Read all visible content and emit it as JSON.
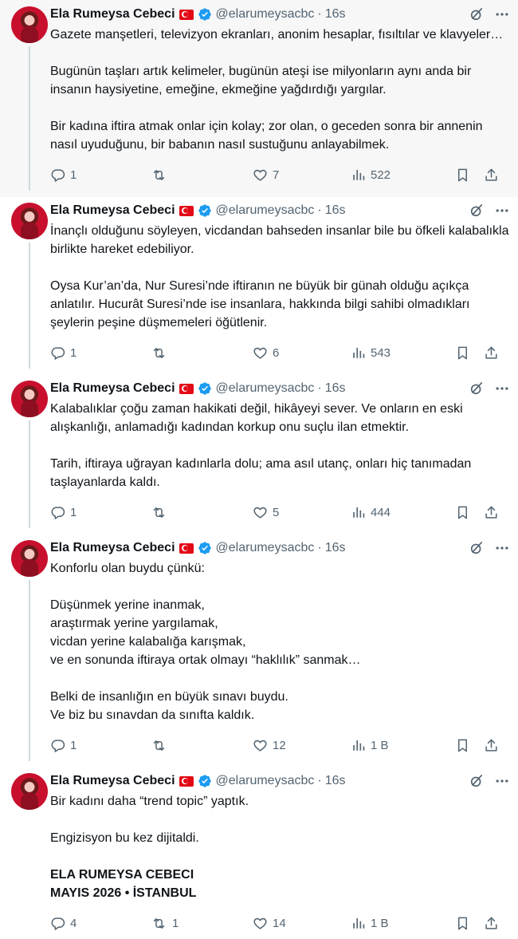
{
  "author": {
    "name": "Ela Rumeysa Cebeci",
    "handle": "@elarumeysacbc",
    "separator": "·",
    "time": "16s"
  },
  "icons": {
    "flag": "turkey-flag-icon",
    "verified": "verified-badge-icon",
    "grok": "grok-icon",
    "more": "more-icon",
    "reply": "reply-icon",
    "retweet": "retweet-icon",
    "like": "heart-icon",
    "views": "views-icon",
    "bookmark": "bookmark-icon",
    "share": "share-icon"
  },
  "colors": {
    "text": "#0f1419",
    "secondary": "#536471",
    "verified": "#1d9bf0",
    "flag": "#e30a17",
    "thread_line": "#cfd9de",
    "highlight_bg": "#f7f7f7"
  },
  "tweets": [
    {
      "paragraphs": [
        "Gazete manşetleri, televizyon ekranları, anonim hesaplar, fısıltılar ve klavyeler…",
        "Bugünün taşları artık kelimeler, bugünün ateşi ise milyonların aynı anda bir insanın haysiyetine, emeğine, ekmeğine yağdırdığı yargılar.",
        "Bir kadına iftira atmak onlar için kolay; zor olan, o geceden sonra bir annenin nasıl uyuduğunu, bir babanın nasıl sustuğunu anlayabilmek."
      ],
      "replies": "1",
      "retweets": "",
      "likes": "7",
      "views": "522"
    },
    {
      "paragraphs": [
        "İnançlı olduğunu söyleyen, vicdandan bahseden insanlar bile bu öfkeli kalabalıkla birlikte hareket edebiliyor.",
        "Oysa Kur’an’da, Nur Suresi’nde iftiranın ne büyük bir günah olduğu açıkça anlatılır. Hucurât Suresi’nde ise insanlara, hakkında bilgi sahibi olmadıkları şeylerin peşine düşmemeleri öğütlenir."
      ],
      "replies": "1",
      "retweets": "",
      "likes": "6",
      "views": "543"
    },
    {
      "paragraphs": [
        "Kalabalıklar çoğu zaman hakikati değil, hikâyeyi sever. Ve onların en eski alışkanlığı, anlamadığı kadından korkup onu suçlu ilan etmektir.",
        "Tarih, iftiraya uğrayan kadınlarla dolu; ama asıl utanç, onları hiç tanımadan taşlayanlarda kaldı."
      ],
      "replies": "1",
      "retweets": "",
      "likes": "5",
      "views": "444"
    },
    {
      "paragraphs": [
        "Konforlu olan buydu çünkü:",
        "Düşünmek yerine inanmak,\naraştırmak yerine yargılamak,\nvicdan yerine kalabalığa karışmak,\nve en sonunda iftiraya ortak olmayı “haklılık” sanmak…",
        "Belki de insanlığın en büyük sınavı buydu.\nVe biz bu sınavdan da sınıfta kaldık."
      ],
      "replies": "1",
      "retweets": "",
      "likes": "12",
      "views": "1 B"
    },
    {
      "paragraphs": [
        "Bir kadını daha “trend topic” yaptık.",
        "Engizisyon bu kez dijitaldi."
      ],
      "signature": "ELA RUMEYSA CEBECI\nMAYIS 2026 • İSTANBUL",
      "replies": "4",
      "retweets": "1",
      "likes": "14",
      "views": "1 B"
    }
  ]
}
